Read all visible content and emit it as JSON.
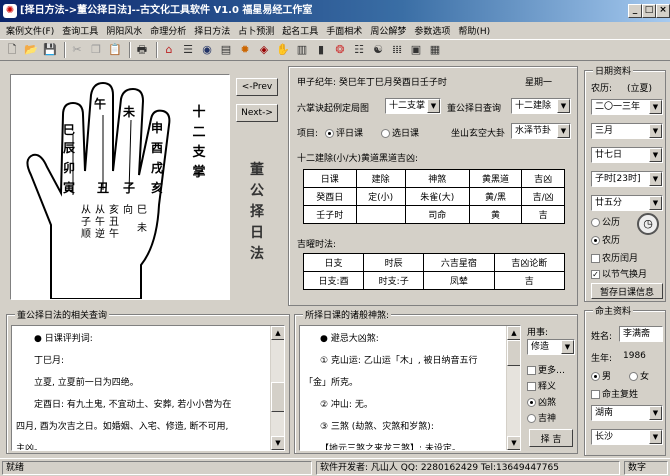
{
  "title": "[择日方法->董公择日法]--古文化工具软件 V1.0  福星易经工作室",
  "menu": [
    "案例文件(F)",
    "查询工具",
    "阴阳风水",
    "命理分析",
    "择日方法",
    "占卜预测",
    "起名工具",
    "手面相术",
    "周公解梦",
    "参数选项",
    "帮助(H)"
  ],
  "palm": {
    "fingers": [
      "午",
      "未",
      "申",
      "巳",
      "辰",
      "卯",
      "寅",
      "丑",
      "子",
      "酉",
      "戌",
      "亥"
    ],
    "caption": "十二支掌",
    "lines": [
      "从子顺",
      "从午逆",
      "亥丑午",
      "向",
      "巳",
      "未"
    ]
  },
  "nav": {
    "prev": "<-Prev",
    "next": "Next->"
  },
  "side_title": "董公择日法",
  "top": {
    "ganzhi": "甲子纪年: 癸巳年丁巳月癸酉日壬子时",
    "weekday": "星期一",
    "method_label": "六掌诀起例定局图",
    "method_value": "十二支掌",
    "dong_label": "董公择日查询",
    "dong_value": "十二建除",
    "item_label": "项目:",
    "opt1": "评日课",
    "opt2": "选日课",
    "tai_label": "坐山玄空大卦",
    "tai_value": "水泽节卦",
    "subhead": "十二建除(小/大)黄道黑道吉凶:",
    "table1": [
      [
        "日课",
        "建除",
        "神煞",
        "黄黑道",
        "吉凶"
      ],
      [
        "癸酉日",
        "定(小)",
        "朱雀(大)",
        "黄/黑",
        "吉/凶"
      ],
      [
        "壬子时",
        "",
        "司命",
        "黄",
        "吉"
      ]
    ],
    "subhead2": "吉曜时法:",
    "table2": [
      [
        "日支",
        "时辰",
        "六吉星宿",
        "吉凶论断"
      ],
      [
        "日支:酉",
        "时支:子",
        "凤辇",
        "吉"
      ]
    ]
  },
  "right": {
    "group": "日期资料",
    "cal_label": "农历:",
    "cal_value": "(立夏)",
    "year": "二〇一三年",
    "month": "三月",
    "day": "廿七日",
    "hour": "子时[23时]",
    "minute": "廿五分",
    "solar": "公历",
    "lunar": "农历",
    "leap": "农历闰月",
    "jieqi": "以节气换月",
    "save": "暂存日课信息"
  },
  "person": {
    "group": "命主资料",
    "name_label": "姓名:",
    "name": "李满斋",
    "born_label": "生年:",
    "born": "1986",
    "male": "男",
    "female": "女",
    "recompute": "命主复姓",
    "province": "湖南",
    "city": "长沙"
  },
  "bottom_left": {
    "group": "董公择日法的相关查询",
    "lines": [
      "● 日课评判词:",
      "丁巳月:",
      "立夏, 立夏前一日为四绝。",
      "定酉日: 有九土鬼, 不宜动土、安葬, 若小小营为在",
      "四月, 酉为次吉之日。如婚姻、入宅、修造, 断不可用,",
      "主凶。"
    ]
  },
  "bottom_mid": {
    "group": "所择日课的诸般神煞:",
    "lines": [
      "● 避忌大凶煞:",
      "① 克山运: 乙山运「木」, 被日纳音五行",
      "「金」所克。",
      "② 冲山: 无。",
      "③ 三煞 (劫煞、灾煞和岁煞):",
      "【地元三煞之来龙三煞】: 未设定。"
    ],
    "use_label": "用事:",
    "use_value": "修造",
    "c1": "更多…",
    "c2": "释义",
    "c3": "凶煞",
    "c4": "吉神",
    "btn": "择 吉"
  },
  "status": {
    "ready": "就绪",
    "dev": "软件开发者: 凡山人 QQ: 2280162429 Tel:13649447765",
    "num": "数字"
  }
}
